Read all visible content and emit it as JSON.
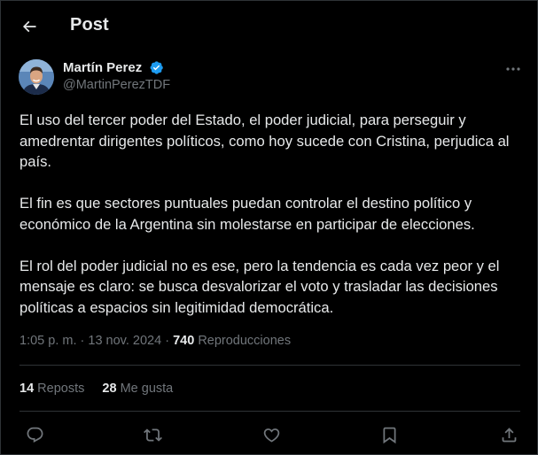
{
  "header": {
    "title": "Post",
    "back_icon": "arrow-left-icon"
  },
  "author": {
    "display_name": "Martín Perez",
    "handle": "@MartinPerezTDF",
    "verified": true,
    "verified_color": "#1d9bf0"
  },
  "post": {
    "paragraphs": [
      "El uso del tercer poder del Estado, el poder judicial, para perseguir y amedrentar dirigentes políticos, como hoy sucede con Cristina, perjudica al país.",
      "El fin es que sectores puntuales puedan controlar el destino político y económico de la Argentina sin molestarse en participar de elecciones.",
      "El rol del poder judicial no es ese, pero la tendencia es cada vez peor y el mensaje es claro: se busca desvalorizar el voto y trasladar las decisiones políticas a espacios sin legitimidad democrática."
    ],
    "time": "1:05 p. m.",
    "separator": "·",
    "date": "13 nov. 2024",
    "views_count": "740",
    "views_label": "Reproducciones"
  },
  "stats": {
    "reposts_count": "14",
    "reposts_label": "Reposts",
    "likes_count": "28",
    "likes_label": "Me gusta"
  },
  "actions": [
    {
      "name": "reply",
      "icon": "reply-icon"
    },
    {
      "name": "repost",
      "icon": "repost-icon"
    },
    {
      "name": "like",
      "icon": "heart-icon"
    },
    {
      "name": "bookmark",
      "icon": "bookmark-icon"
    },
    {
      "name": "share",
      "icon": "share-icon"
    }
  ],
  "colors": {
    "background": "#000000",
    "text": "#e7e9ea",
    "secondary_text": "#71767b",
    "border": "#2f3336",
    "accent": "#1d9bf0"
  }
}
